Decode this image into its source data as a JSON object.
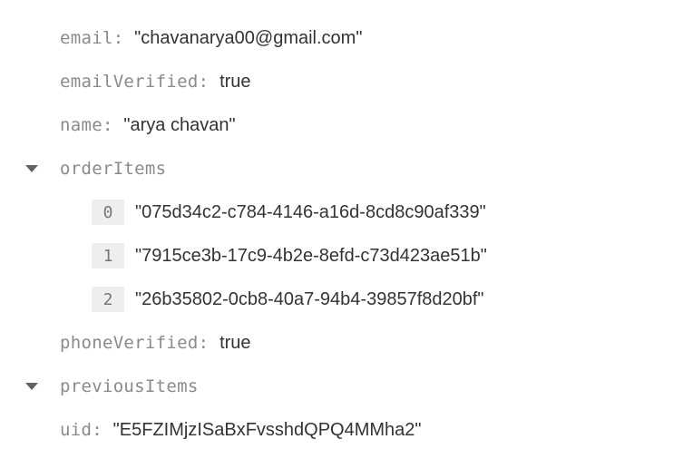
{
  "fields": {
    "email": {
      "key": "email",
      "value": "\"chavanarya00@gmail.com\""
    },
    "emailVerified": {
      "key": "emailVerified",
      "value": "true"
    },
    "name": {
      "key": "name",
      "value": "\"arya chavan\""
    },
    "orderItems": {
      "key": "orderItems",
      "items": [
        {
          "index": "0",
          "value": "\"075d34c2-c784-4146-a16d-8cd8c90af339\""
        },
        {
          "index": "1",
          "value": "\"7915ce3b-17c9-4b2e-8efd-c73d423ae51b\""
        },
        {
          "index": "2",
          "value": "\"26b35802-0cb8-40a7-94b4-39857f8d20bf\""
        }
      ]
    },
    "phoneVerified": {
      "key": "phoneVerified",
      "value": "true"
    },
    "previousItems": {
      "key": "previousItems"
    },
    "uid": {
      "key": "uid",
      "value": "\"E5FZIMjzISaBxFvsshdQPQ4MMha2\""
    }
  },
  "colors": {
    "key_text": "#8a8a8a",
    "value_text": "#333333",
    "index_badge_bg": "#eeeeee",
    "caret": "#5f6368"
  },
  "icons": {
    "expand": "caret-down-icon"
  }
}
